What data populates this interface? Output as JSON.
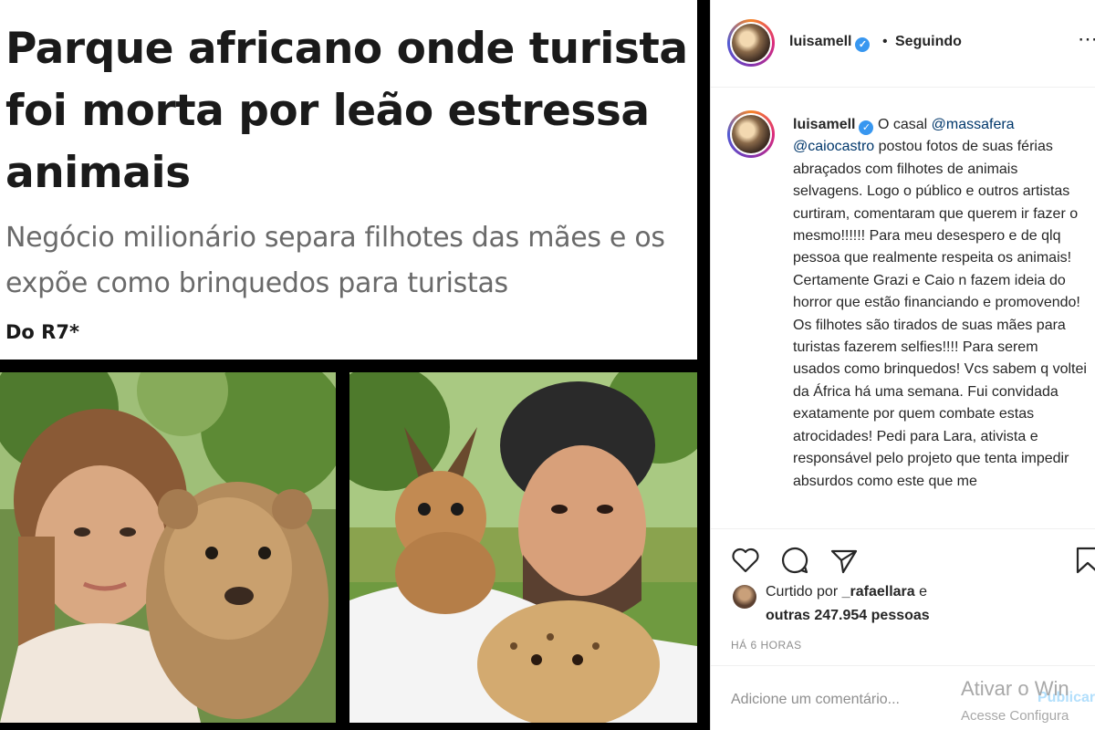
{
  "post_image": {
    "headline": "Parque africano onde turista foi morta por leão estressa animais",
    "subheadline": "Negócio milionário separa filhotes das mães e os expõe como brinquedos para turistas",
    "source": "Do R7*"
  },
  "header": {
    "username": "luisamell",
    "verified_glyph": "✓",
    "separator": "•",
    "follow_state": "Seguindo",
    "more_glyph": "⋯"
  },
  "caption": {
    "username": "luisamell",
    "text_before_mentions": "O casal ",
    "mention1": "@massafera",
    "mention2": "@caiocastro",
    "text": " postou fotos de suas férias abraçados com filhotes de animais selvagens. Logo o público e outros artistas curtiram, comentaram que querem ir fazer o mesmo!!!!!! Para meu desespero e de qlq pessoa que realmente respeita os animais! Certamente Grazi e Caio n fazem ideia do horror que estão financiando e promovendo! Os filhotes são tirados de suas mães para turistas fazerem selfies!!!! Para serem usados como brinquedos! Vcs sabem q voltei da África há uma semana. Fui convidada exatamente por quem combate estas atrocidades! Pedi para Lara, ativista e responsável pelo projeto que tenta impedir absurdos como este que me"
  },
  "actions": {
    "icons": [
      "heart-icon",
      "comment-icon",
      "share-icon",
      "bookmark-icon"
    ],
    "liked_by_prefix": "Curtido por",
    "liked_by_user": "_rafaellara",
    "liked_by_conj": "e",
    "others_prefix": "outras",
    "others_count": "247.954 pessoas",
    "timestamp": "HÁ 6 HORAS"
  },
  "comment": {
    "placeholder": "Adicione um comentário...",
    "publish_label": "Publicar"
  },
  "system_watermark": {
    "line1": "Ativar o Win",
    "line2": "Acesse Configura"
  },
  "colors": {
    "verified": "#3897f0",
    "mention": "#00376b",
    "publish_disabled": "#b2dffc"
  }
}
